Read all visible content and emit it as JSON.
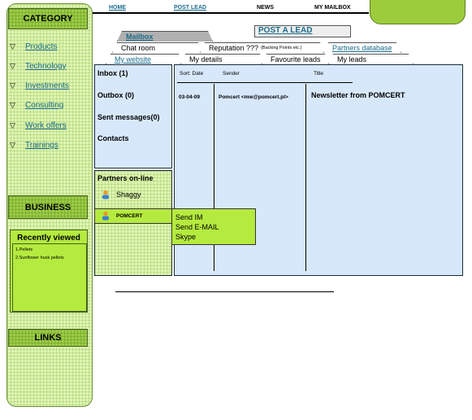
{
  "sidebar": {
    "category_label": "CATEGORY",
    "categories": [
      "Products",
      "Technology",
      "Investments",
      "Consulting",
      "Work offers",
      "Trainings"
    ],
    "bullet": "▽",
    "business_label": "BUSINESS",
    "recently_viewed": {
      "title": "Recently viewed",
      "items": [
        "1.Pellets",
        "2.Sunflower husk pellets"
      ]
    },
    "links_label": "LINKS"
  },
  "topnav": {
    "home": "HOME",
    "post_lead": "POST LEAD",
    "news": "NEWS",
    "my_mailbox": "MY MAILBOX"
  },
  "tabs": {
    "mailbox": "Mailbox",
    "post_a_lead": "POST A LEAD",
    "chat_room": "Chat room",
    "reputation": "Reputation ???",
    "reputation_note": "(Backing Points etc.)",
    "partners_db": "Partners database",
    "my_website": "My website",
    "my_details": "My details",
    "favourite_leads": "Favourite leads",
    "my_leads": "My leads"
  },
  "mailbox": {
    "inbox": "Inbox (1)",
    "outbox": "Outbox (0)",
    "sent": "Sent messages(0)",
    "contacts": "Contacts"
  },
  "partners": {
    "title": "Partners on-line",
    "items": [
      "Shaggy",
      "POMCERT"
    ]
  },
  "context_menu": [
    "Send IM",
    "Send E-MAIL",
    "Skype"
  ],
  "messages": {
    "headers": {
      "sort": "Sort: Date",
      "sender": "Sender",
      "title": "Title"
    },
    "rows": [
      {
        "date": "03-04-09",
        "sender": "Pomcert <mw@pomcert.pl>",
        "title": "Newsletter from POMCERT"
      }
    ]
  },
  "colors": {
    "accent_green": "#9ccc44",
    "panel_blue": "#d8e8fb",
    "link_teal": "#1a6b8a"
  }
}
